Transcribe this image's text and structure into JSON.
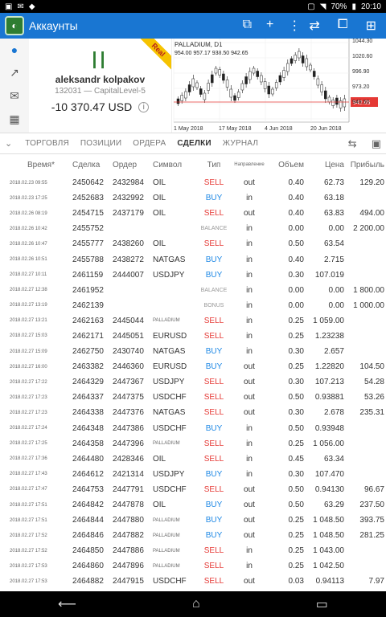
{
  "status": {
    "battery": "70%",
    "time": "20:10"
  },
  "app": {
    "title": "Аккаунты"
  },
  "account": {
    "badge": "Real",
    "name": "aleksandr kolpakov",
    "sub": "132031 — CapitalLevel-5",
    "balance": "-10 370.47 USD",
    "info": "i"
  },
  "chart": {
    "symbol_line": "PALLADIUM, D1",
    "ohlc_line": "954.00 957.17 938.50 942.65",
    "yticks": [
      "1044.30",
      "1020.60",
      "996.90",
      "973.20",
      "949.50"
    ],
    "price_tag": "942.65",
    "xticks": [
      "1 May 2018",
      "17 May 2018",
      "4 Jun 2018",
      "20 Jun 2018"
    ]
  },
  "tabs": [
    "ТОРГОВЛЯ",
    "ПОЗИЦИИ",
    "ОРДЕРА",
    "СДЕЛКИ",
    "ЖУРНАЛ"
  ],
  "active_tab": "СДЕЛКИ",
  "columns": [
    "Время*",
    "Сделка",
    "Ордер",
    "Символ",
    "Тип",
    "Направление",
    "Объем",
    "Цена",
    "Прибыль"
  ],
  "rows": [
    {
      "time": "2018.02.23 09:55",
      "deal": "2450642",
      "order": "2432984",
      "symbol": "OIL",
      "type": "SELL",
      "dir": "out",
      "vol": "0.40",
      "price": "62.73",
      "profit": "129.20"
    },
    {
      "time": "2018.02.23 17:25",
      "deal": "2452683",
      "order": "2432992",
      "symbol": "OIL",
      "type": "BUY",
      "dir": "in",
      "vol": "0.40",
      "price": "63.18",
      "profit": ""
    },
    {
      "time": "2018.02.26 08:19",
      "deal": "2454715",
      "order": "2437179",
      "symbol": "OIL",
      "type": "SELL",
      "dir": "out",
      "vol": "0.40",
      "price": "63.83",
      "profit": "494.00"
    },
    {
      "time": "2018.02.26 10:42",
      "deal": "2455752",
      "order": "",
      "symbol": "",
      "type": "BALANCE",
      "dir": "in",
      "vol": "0.00",
      "price": "0.00",
      "profit": "2 200.00"
    },
    {
      "time": "2018.02.26 10:47",
      "deal": "2455777",
      "order": "2438260",
      "symbol": "OIL",
      "type": "SELL",
      "dir": "in",
      "vol": "0.50",
      "price": "63.54",
      "profit": ""
    },
    {
      "time": "2018.02.26 10:51",
      "deal": "2455788",
      "order": "2438272",
      "symbol": "NATGAS",
      "type": "BUY",
      "dir": "in",
      "vol": "0.40",
      "price": "2.715",
      "profit": ""
    },
    {
      "time": "2018.02.27 10:11",
      "deal": "2461159",
      "order": "2444007",
      "symbol": "USDJPY",
      "type": "BUY",
      "dir": "in",
      "vol": "0.30",
      "price": "107.019",
      "profit": ""
    },
    {
      "time": "2018.02.27 12:38",
      "deal": "2461952",
      "order": "",
      "symbol": "",
      "type": "BALANCE",
      "dir": "in",
      "vol": "0.00",
      "price": "0.00",
      "profit": "1 800.00"
    },
    {
      "time": "2018.02.27 13:19",
      "deal": "2462139",
      "order": "",
      "symbol": "",
      "type": "BONUS",
      "dir": "in",
      "vol": "0.00",
      "price": "0.00",
      "profit": "1 000.00"
    },
    {
      "time": "2018.02.27 13:21",
      "deal": "2462163",
      "order": "2445044",
      "symbol": "PALLADIUM",
      "type": "SELL",
      "dir": "in",
      "vol": "0.25",
      "price": "1 059.00",
      "profit": ""
    },
    {
      "time": "2018.02.27 15:03",
      "deal": "2462171",
      "order": "2445051",
      "symbol": "EURUSD",
      "type": "SELL",
      "dir": "in",
      "vol": "0.25",
      "price": "1.23238",
      "profit": ""
    },
    {
      "time": "2018.02.27 15:09",
      "deal": "2462750",
      "order": "2430740",
      "symbol": "NATGAS",
      "type": "BUY",
      "dir": "in",
      "vol": "0.30",
      "price": "2.657",
      "profit": ""
    },
    {
      "time": "2018.02.27 16:00",
      "deal": "2463382",
      "order": "2446360",
      "symbol": "EURUSD",
      "type": "BUY",
      "dir": "out",
      "vol": "0.25",
      "price": "1.22820",
      "profit": "104.50"
    },
    {
      "time": "2018.02.27 17:22",
      "deal": "2464329",
      "order": "2447367",
      "symbol": "USDJPY",
      "type": "SELL",
      "dir": "out",
      "vol": "0.30",
      "price": "107.213",
      "profit": "54.28"
    },
    {
      "time": "2018.02.27 17:23",
      "deal": "2464337",
      "order": "2447375",
      "symbol": "USDCHF",
      "type": "SELL",
      "dir": "out",
      "vol": "0.50",
      "price": "0.93881",
      "profit": "53.26"
    },
    {
      "time": "2018.02.27 17:23",
      "deal": "2464338",
      "order": "2447376",
      "symbol": "NATGAS",
      "type": "SELL",
      "dir": "out",
      "vol": "0.30",
      "price": "2.678",
      "profit": "235.31"
    },
    {
      "time": "2018.02.27 17:24",
      "deal": "2464348",
      "order": "2447386",
      "symbol": "USDCHF",
      "type": "BUY",
      "dir": "in",
      "vol": "0.50",
      "price": "0.93948",
      "profit": ""
    },
    {
      "time": "2018.02.27 17:25",
      "deal": "2464358",
      "order": "2447396",
      "symbol": "PALLADIUM",
      "type": "SELL",
      "dir": "in",
      "vol": "0.25",
      "price": "1 056.00",
      "profit": ""
    },
    {
      "time": "2018.02.27 17:36",
      "deal": "2464480",
      "order": "2428346",
      "symbol": "OIL",
      "type": "SELL",
      "dir": "in",
      "vol": "0.45",
      "price": "63.34",
      "profit": ""
    },
    {
      "time": "2018.02.27 17:43",
      "deal": "2464612",
      "order": "2421314",
      "symbol": "USDJPY",
      "type": "BUY",
      "dir": "in",
      "vol": "0.30",
      "price": "107.470",
      "profit": ""
    },
    {
      "time": "2018.02.27 17:47",
      "deal": "2464753",
      "order": "2447791",
      "symbol": "USDCHF",
      "type": "SELL",
      "dir": "out",
      "vol": "0.50",
      "price": "0.94130",
      "profit": "96.67"
    },
    {
      "time": "2018.02.27 17:51",
      "deal": "2464842",
      "order": "2447878",
      "symbol": "OIL",
      "type": "BUY",
      "dir": "out",
      "vol": "0.50",
      "price": "63.29",
      "profit": "237.50"
    },
    {
      "time": "2018.02.27 17:51",
      "deal": "2464844",
      "order": "2447880",
      "symbol": "PALLADIUM",
      "type": "BUY",
      "dir": "out",
      "vol": "0.25",
      "price": "1 048.50",
      "profit": "393.75"
    },
    {
      "time": "2018.02.27 17:52",
      "deal": "2464846",
      "order": "2447882",
      "symbol": "PALLADIUM",
      "type": "BUY",
      "dir": "out",
      "vol": "0.25",
      "price": "1 048.50",
      "profit": "281.25"
    },
    {
      "time": "2018.02.27 17:52",
      "deal": "2464850",
      "order": "2447886",
      "symbol": "PALLADIUM",
      "type": "SELL",
      "dir": "in",
      "vol": "0.25",
      "price": "1 043.00",
      "profit": ""
    },
    {
      "time": "2018.02.27 17:53",
      "deal": "2464860",
      "order": "2447896",
      "symbol": "PALLADIUM",
      "type": "SELL",
      "dir": "in",
      "vol": "0.25",
      "price": "1 042.50",
      "profit": ""
    },
    {
      "time": "2018.02.27 17:53",
      "deal": "2464882",
      "order": "2447915",
      "symbol": "USDCHF",
      "type": "SELL",
      "dir": "out",
      "vol": "0.03",
      "price": "0.94113",
      "profit": "7.97"
    }
  ]
}
